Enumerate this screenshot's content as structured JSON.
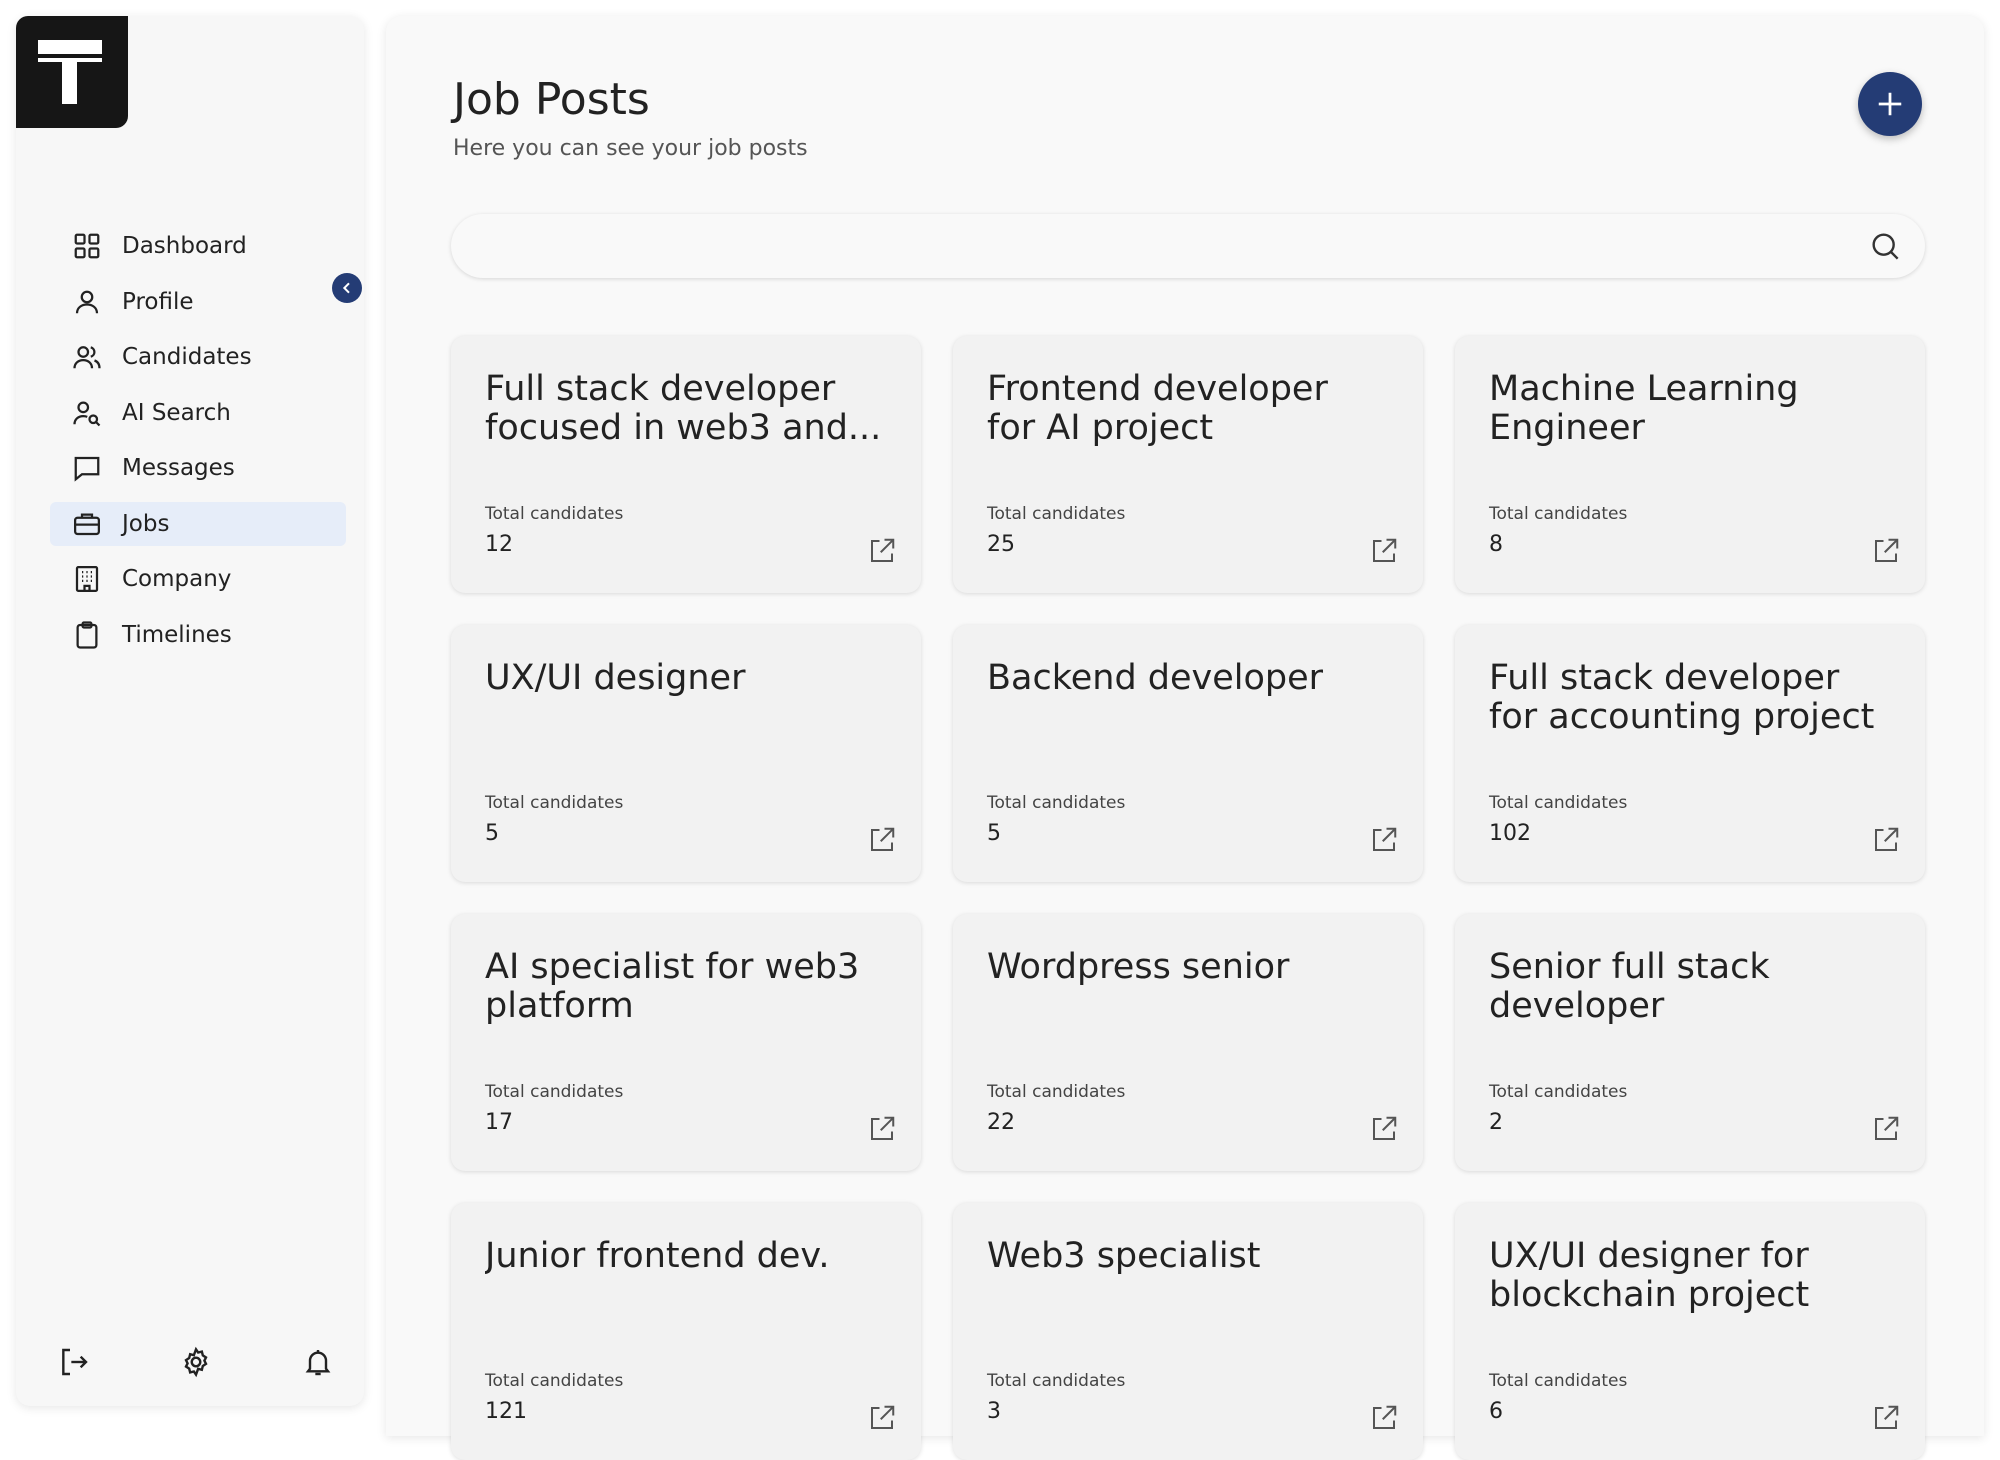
{
  "sidebar": {
    "items": [
      {
        "label": "Dashboard",
        "icon": "grid-icon"
      },
      {
        "label": "Profile",
        "icon": "user-icon"
      },
      {
        "label": "Candidates",
        "icon": "users-icon"
      },
      {
        "label": "AI Search",
        "icon": "user-search-icon"
      },
      {
        "label": "Messages",
        "icon": "message-icon"
      },
      {
        "label": "Jobs",
        "icon": "briefcase-icon",
        "active": true
      },
      {
        "label": "Company",
        "icon": "building-icon"
      },
      {
        "label": "Timelines",
        "icon": "clipboard-icon"
      }
    ],
    "footer_icons": [
      "logout-icon",
      "settings-gear-icon",
      "bell-icon"
    ]
  },
  "main": {
    "title": "Job Posts",
    "subtitle": "Here you can see your job posts",
    "search": {
      "value": "",
      "placeholder": ""
    },
    "cards": [
      {
        "title": "Full stack developer focused in web3 and...",
        "label": "Total candidates",
        "count": "12"
      },
      {
        "title": "Frontend developer for AI project",
        "label": "Total candidates",
        "count": "25"
      },
      {
        "title": "Machine Learning Engineer",
        "label": "Total candidates",
        "count": "8"
      },
      {
        "title": "UX/UI designer",
        "label": "Total candidates",
        "count": "5"
      },
      {
        "title": "Backend developer",
        "label": "Total candidates",
        "count": "5"
      },
      {
        "title": "Full stack developer for accounting project",
        "label": "Total candidates",
        "count": "102"
      },
      {
        "title": "AI specialist for web3 platform",
        "label": "Total candidates",
        "count": "17"
      },
      {
        "title": "Wordpress senior",
        "label": "Total candidates",
        "count": "22"
      },
      {
        "title": "Senior full stack developer",
        "label": "Total candidates",
        "count": "2"
      },
      {
        "title": "Junior frontend dev.",
        "label": "Total candidates",
        "count": "121"
      },
      {
        "title": "Web3 specialist",
        "label": "Total candidates",
        "count": "3"
      },
      {
        "title": "UX/UI designer for blockchain project",
        "label": "Total candidates",
        "count": "6"
      }
    ]
  },
  "colors": {
    "accent": "#243c75",
    "active_nav_bg": "#e6edf9",
    "card_bg": "#f2f2f2"
  }
}
